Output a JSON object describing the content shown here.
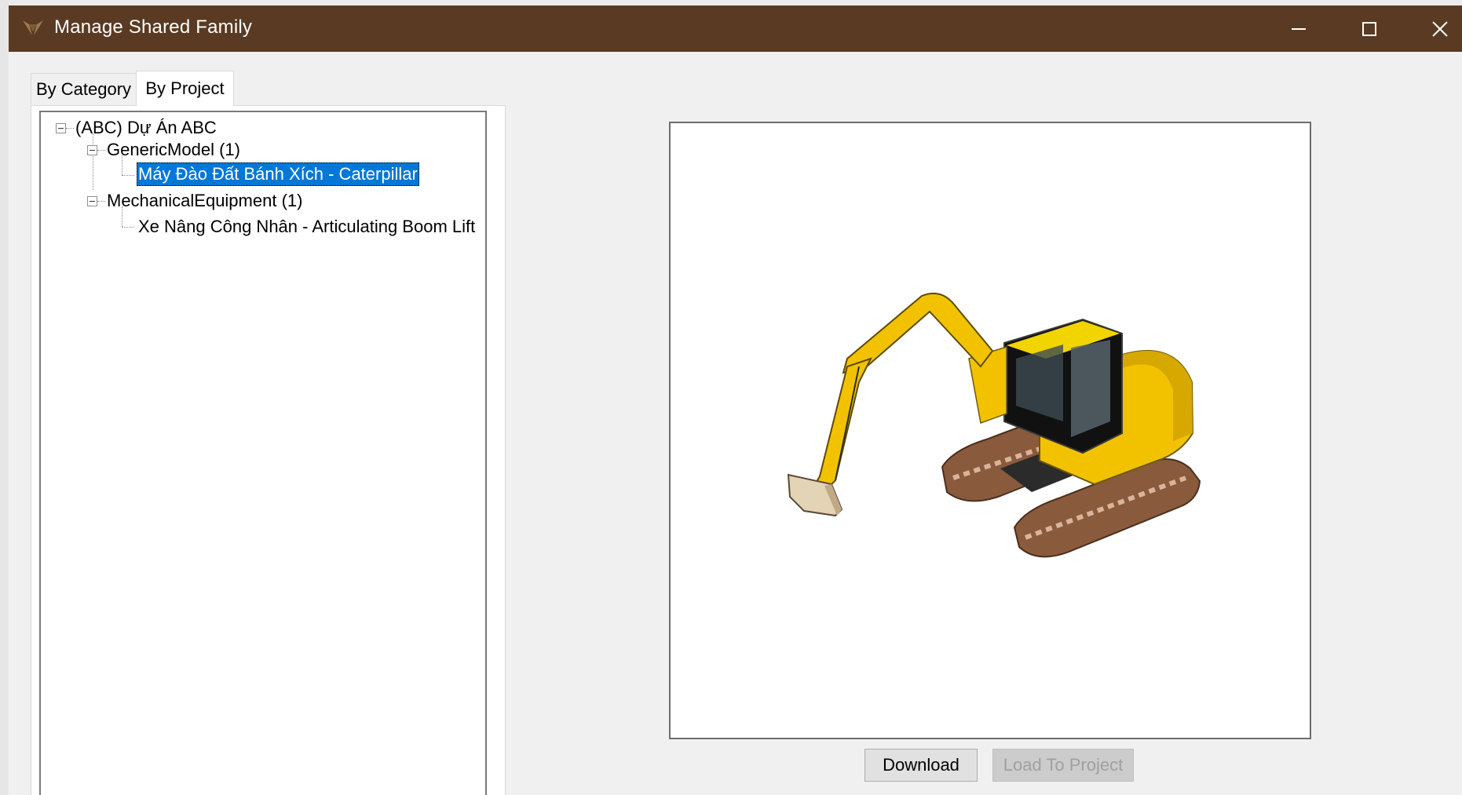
{
  "window": {
    "title": "Manage Shared Family",
    "titlebar_color": "#5a3a22",
    "icon": "app-logo-icon",
    "controls": {
      "minimize_icon": "minimize-icon",
      "maximize_icon": "maximize-icon",
      "close_icon": "close-icon"
    }
  },
  "tabs": [
    {
      "label": "By Category",
      "selected": false
    },
    {
      "label": "By Project",
      "selected": true
    }
  ],
  "tree": {
    "root": {
      "label": "(ABC) Dự Án ABC",
      "expanded": true
    },
    "groups": [
      {
        "label": "GenericModel (1)",
        "expanded": true,
        "items": [
          {
            "label": "Máy Đào Đất Bánh Xích - Caterpillar",
            "selected": true
          }
        ]
      },
      {
        "label": "MechanicalEquipment (1)",
        "expanded": true,
        "items": [
          {
            "label": "Xe Nâng Công Nhân - Articulating Boom Lift",
            "selected": false
          }
        ]
      }
    ],
    "selection_color": "#0078d7"
  },
  "preview": {
    "image": "excavator-preview-image"
  },
  "buttons": {
    "download": {
      "label": "Download",
      "enabled": true
    },
    "load_to_project": {
      "label": "Load To Project",
      "enabled": false
    }
  }
}
